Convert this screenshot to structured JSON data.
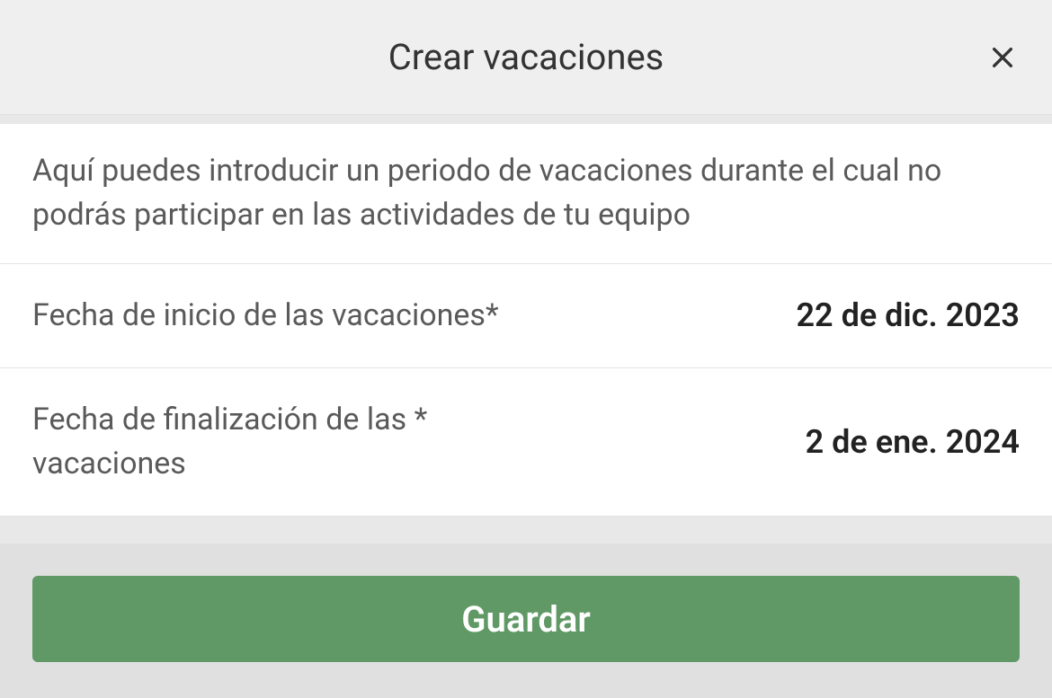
{
  "header": {
    "title": "Crear vacaciones"
  },
  "description": "Aquí puedes introducir un periodo de vacaciones durante el cual no podrás participar en las actividades de tu equipo",
  "fields": {
    "startDate": {
      "label": "Fecha de inicio de las vacaciones*",
      "value": "22 de dic. 2023"
    },
    "endDate": {
      "label": "Fecha de finalización de las * vacaciones",
      "value": "2 de ene. 2024"
    }
  },
  "actions": {
    "save": "Guardar"
  }
}
